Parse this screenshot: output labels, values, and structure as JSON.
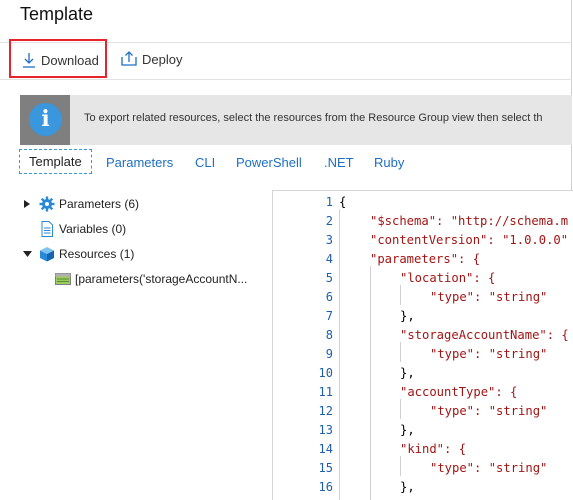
{
  "header": {
    "title": "Template"
  },
  "toolbar": {
    "download_label": "Download",
    "deploy_label": "Deploy"
  },
  "info": {
    "message": "To export related resources, select the resources from the Resource Group view then select th"
  },
  "tabs": [
    {
      "label": "Template"
    },
    {
      "label": "Parameters"
    },
    {
      "label": "CLI"
    },
    {
      "label": "PowerShell"
    },
    {
      "label": ".NET"
    },
    {
      "label": "Ruby"
    }
  ],
  "tree": {
    "parameters": "Parameters (6)",
    "variables": "Variables (0)",
    "resources": "Resources (1)",
    "resource_item": "[parameters('storageAccountN..."
  },
  "editor": {
    "line_numbers": [
      "1",
      "2",
      "3",
      "4",
      "5",
      "6",
      "7",
      "8",
      "9",
      "10",
      "11",
      "12",
      "13",
      "14",
      "15",
      "16"
    ],
    "lines": [
      "{",
      "\"$schema\": \"http://schema.m",
      "\"contentVersion\": \"1.0.0.0\"",
      "\"parameters\": {",
      "\"location\": {",
      "\"type\": \"string\"",
      "},",
      "\"storageAccountName\": {",
      "\"type\": \"string\"",
      "},",
      "\"accountType\": {",
      "\"type\": \"string\"",
      "},",
      "\"kind\": {",
      "\"type\": \"string\"",
      "},"
    ]
  }
}
